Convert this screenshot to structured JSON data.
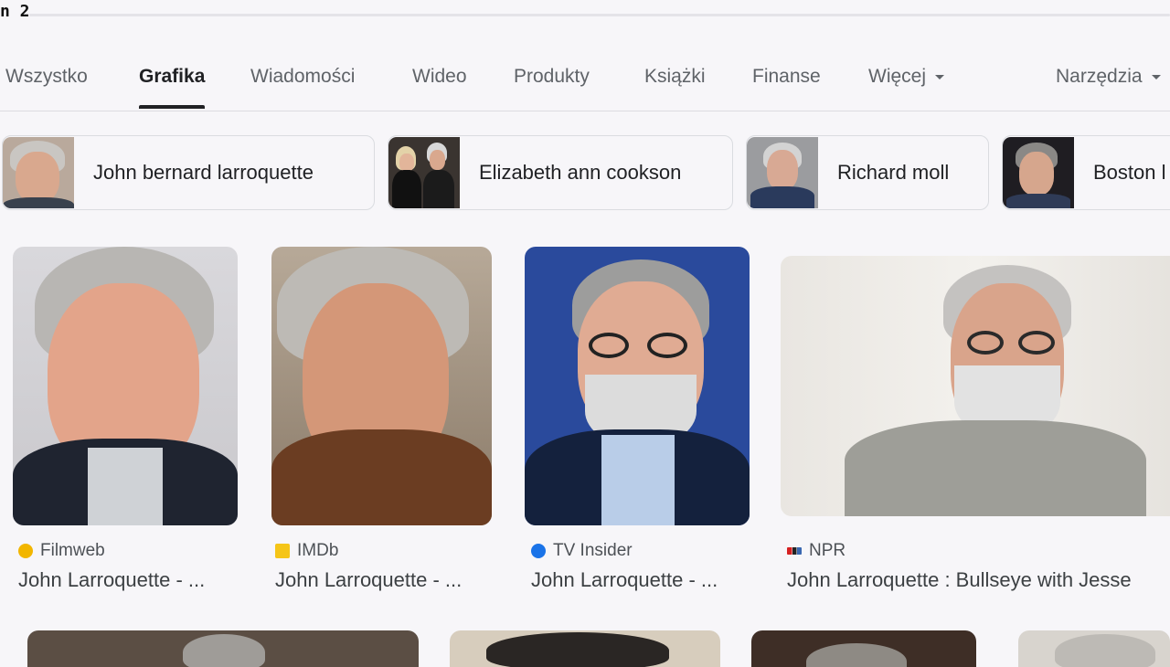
{
  "corner_text": "n 2",
  "tabs": {
    "all": "Wszystko",
    "images": "Grafika",
    "news": "Wiadomości",
    "video": "Wideo",
    "products": "Produkty",
    "books": "Książki",
    "finance": "Finanse",
    "more": "Więcej",
    "tools": "Narzędzia"
  },
  "chips": [
    {
      "label": "John bernard larroquette"
    },
    {
      "label": "Elizabeth ann cookson"
    },
    {
      "label": "Richard moll"
    },
    {
      "label": "Boston l"
    }
  ],
  "results": [
    {
      "source": "Filmweb",
      "title": "John Larroquette - ...",
      "icon_color": "#f2b600"
    },
    {
      "source": "IMDb",
      "title": "John Larroquette - ...",
      "icon_color": "#f5c518"
    },
    {
      "source": "TV Insider",
      "title": "John Larroquette - ...",
      "icon_color": "#1a73e8"
    },
    {
      "source": "NPR",
      "title": "John Larroquette : Bullseye with Jesse",
      "icon_color": "#d62021"
    }
  ],
  "colors": {
    "background": "#f7f6f9",
    "active_tab": "#202124",
    "inactive_tab": "#5f6368"
  }
}
